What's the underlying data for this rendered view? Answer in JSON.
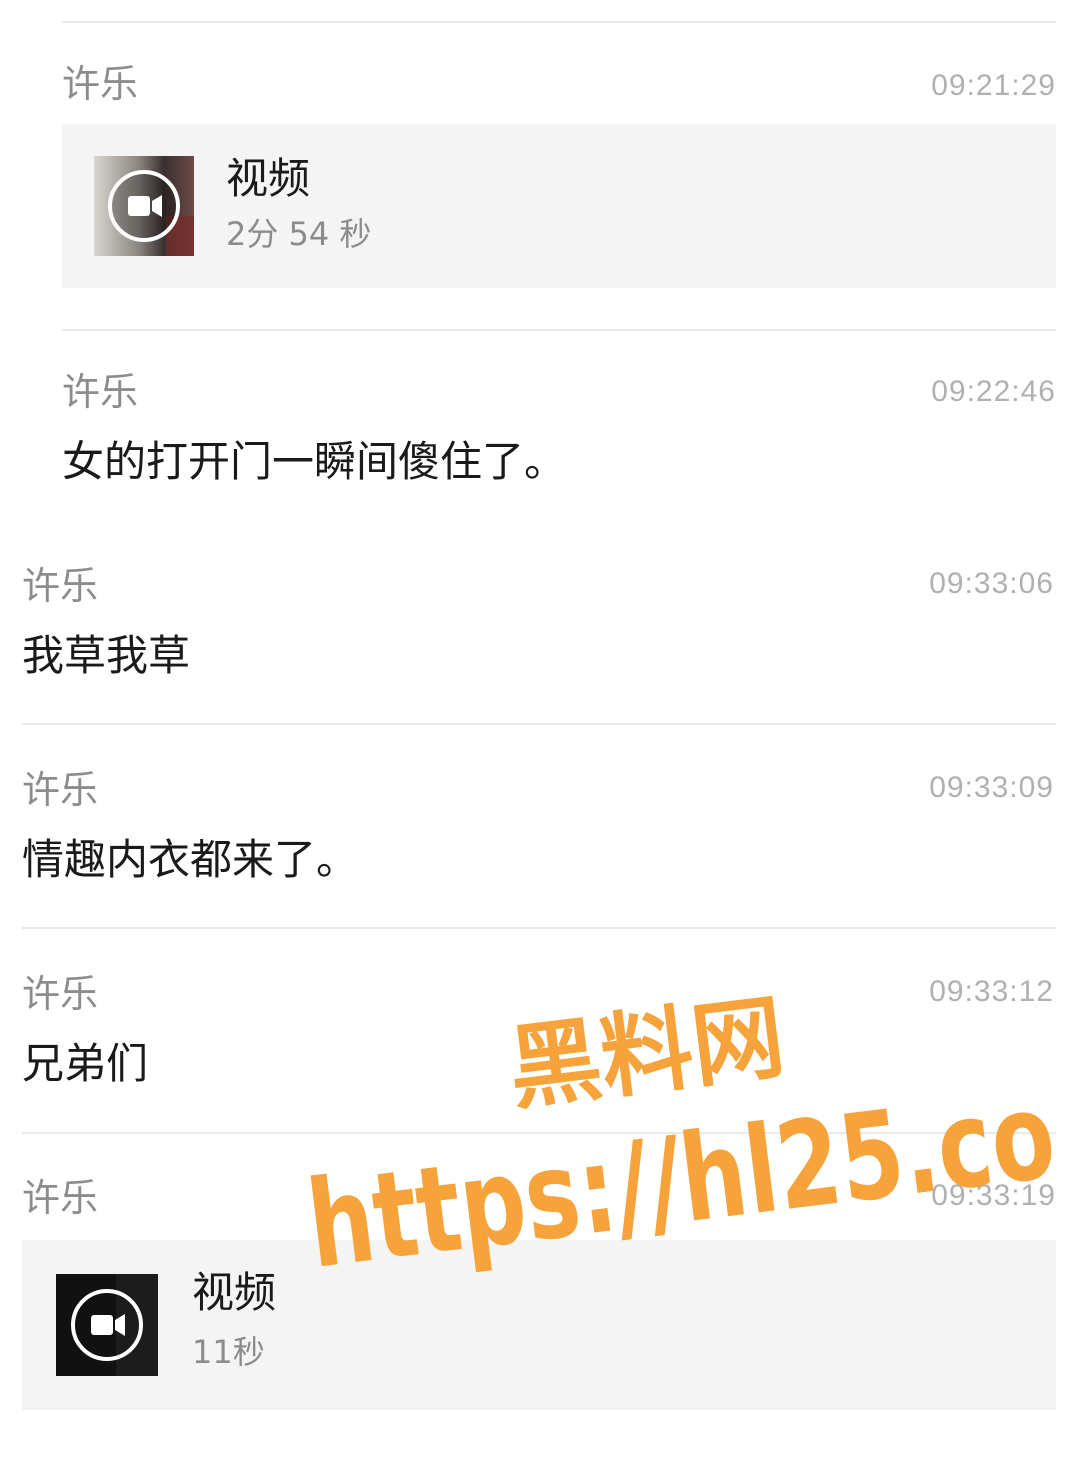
{
  "messages": [
    {
      "sender": "许乐",
      "time": "09:21:29",
      "type": "video",
      "video_title": "视频",
      "video_duration": "2分 54 秒"
    },
    {
      "sender": "许乐",
      "time": "09:22:46",
      "type": "text",
      "text": "女的打开门一瞬间傻住了。"
    },
    {
      "sender": "许乐",
      "time": "09:33:06",
      "type": "text",
      "text": "我草我草"
    },
    {
      "sender": "许乐",
      "time": "09:33:09",
      "type": "text",
      "text": "情趣内衣都来了。"
    },
    {
      "sender": "许乐",
      "time": "09:33:12",
      "type": "text",
      "text": "兄弟们"
    },
    {
      "sender": "许乐",
      "time": "09:33:19",
      "type": "video",
      "video_title": "视频",
      "video_duration": "11秒"
    }
  ],
  "watermark": {
    "line1": "黑料网",
    "line2": "https://hl25.co",
    "color": "#f5a33a"
  },
  "icons": {
    "video": "video-camera-icon"
  }
}
